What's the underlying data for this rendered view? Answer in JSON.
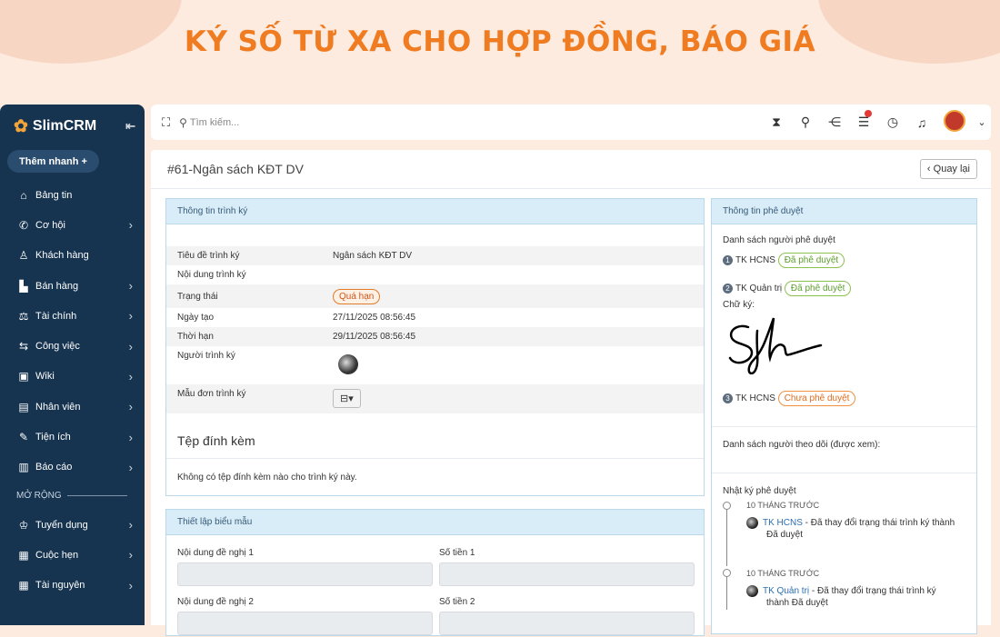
{
  "banner": "KÝ SỐ TỪ XA CHO HỢP ĐỒNG, BÁO GIÁ",
  "sidebar": {
    "brand": "SlimCRM",
    "quick_add": "Thêm nhanh",
    "items": [
      {
        "label": "Bảng tin",
        "icon": "home-icon",
        "chev": false
      },
      {
        "label": "Cơ hội",
        "icon": "phone-icon",
        "chev": true
      },
      {
        "label": "Khách hàng",
        "icon": "user-icon",
        "chev": false
      },
      {
        "label": "Bán hàng",
        "icon": "cart-icon",
        "chev": true
      },
      {
        "label": "Tài chính",
        "icon": "scale-icon",
        "chev": true
      },
      {
        "label": "Công việc",
        "icon": "handshake-icon",
        "chev": true
      },
      {
        "label": "Wiki",
        "icon": "wiki-icon",
        "chev": true
      },
      {
        "label": "Nhân viên",
        "icon": "id-card-icon",
        "chev": true
      },
      {
        "label": "Tiện ích",
        "icon": "wrench-icon",
        "chev": true
      },
      {
        "label": "Báo cáo",
        "icon": "chart-icon",
        "chev": true
      }
    ],
    "section": "MỞ RỘNG",
    "ext_items": [
      {
        "label": "Tuyển dụng",
        "icon": "graduation-icon",
        "chev": true
      },
      {
        "label": "Cuộc hẹn",
        "icon": "calendar-check-icon",
        "chev": true
      },
      {
        "label": "Tài nguyên",
        "icon": "calendar-icon",
        "chev": true
      }
    ]
  },
  "topbar": {
    "search_placeholder": "Tìm kiếm..."
  },
  "page": {
    "title": "#61-Ngân sách KĐT DV",
    "back": "Quay lại"
  },
  "info": {
    "header": "Thông tin trình ký",
    "rows": [
      {
        "k": "Tiêu đề trình ký",
        "v": "Ngân sách KĐT DV"
      },
      {
        "k": "Nội dung trình ký",
        "v": ""
      },
      {
        "k": "Trạng thái",
        "v": "Quá hạn"
      },
      {
        "k": "Ngày tạo",
        "v": "27/11/2025 08:56:45"
      },
      {
        "k": "Thời hạn",
        "v": "29/11/2025 08:56:45"
      },
      {
        "k": "Người trình ký",
        "v": ""
      },
      {
        "k": "Mẫu đơn trình ký",
        "v": ""
      }
    ],
    "attach_title": "Tệp đính kèm",
    "attach_empty": "Không có tệp đính kèm nào cho trình ký này."
  },
  "form": {
    "header": "Thiết lập biểu mẫu",
    "l1": "Nội dung đề nghị 1",
    "r1": "Số tiền 1",
    "l2": "Nội dung đề nghị 2",
    "r2": "Số tiền 2"
  },
  "approval": {
    "header": "Thông tin phê duyệt",
    "list_title": "Danh sách người phê duyệt",
    "approvers": [
      {
        "n": "1",
        "name": "TK HCNS",
        "status": "Đã phê duyệt"
      },
      {
        "n": "2",
        "name": "TK Quản trị",
        "status": "Đã phê duyệt"
      },
      {
        "n": "3",
        "name": "TK HCNS",
        "status": "Chưa phê duyệt"
      }
    ],
    "sig_label": "Chữ ký:",
    "watchers": "Danh sách người theo dõi (được xem):",
    "log_title": "Nhật ký phê duyệt",
    "log": [
      {
        "time": "10 THÁNG TRƯỚC",
        "user": "TK HCNS",
        "text": " - Đã thay đổi trạng thái trình ký thành",
        "text2": "Đã duyệt"
      },
      {
        "time": "10 THÁNG TRƯỚC",
        "user": "TK Quản trị",
        "text": " - Đã thay đổi trạng thái trình ký",
        "text2": "thành Đã duyệt"
      }
    ]
  },
  "colors": {
    "sidebar": "#163450",
    "accent": "#f07c22"
  }
}
